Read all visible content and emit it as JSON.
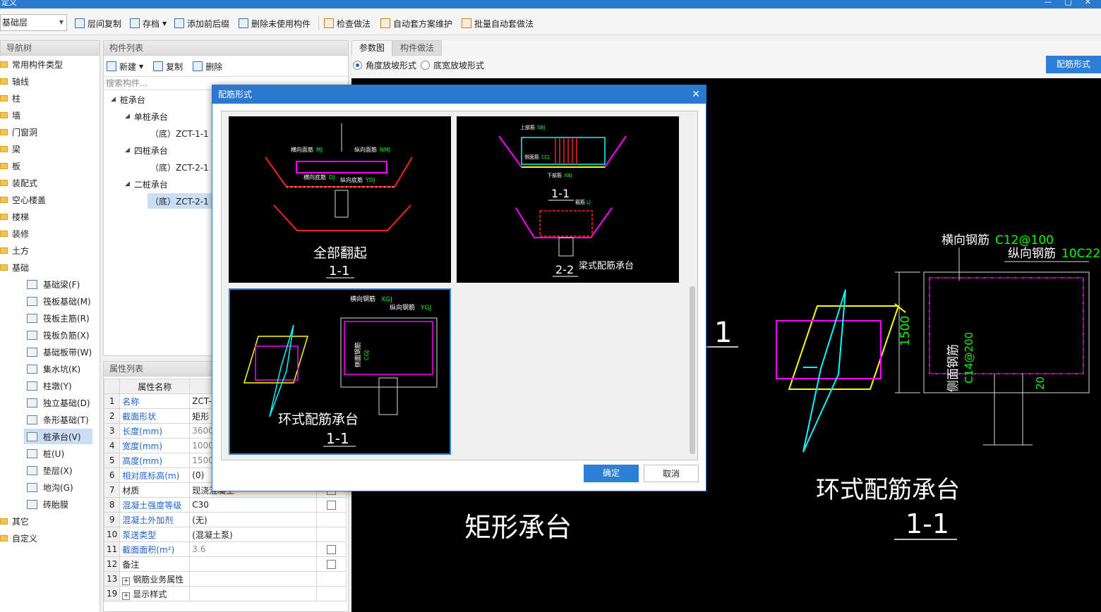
{
  "window": {
    "title": "定义",
    "controls": [
      "—",
      "□",
      "✕"
    ]
  },
  "toolbar": {
    "floor_value": "基础层",
    "items": [
      "层间复制",
      "存档",
      "添加前后缀",
      "删除未使用构件",
      "检查做法",
      "自动套方案维护",
      "批量自动套做法"
    ]
  },
  "nav": {
    "header": "导航树",
    "folders": [
      "常用构件类型",
      "轴线",
      "柱",
      "墙",
      "门窗洞",
      "梁",
      "板",
      "装配式",
      "空心楼盖",
      "楼梯",
      "装修",
      "土方",
      "基础"
    ],
    "foundation_items": [
      "基础梁(F)",
      "筏板基础(M)",
      "筏板主筋(R)",
      "筏板负筋(X)",
      "基础板带(W)",
      "集水坑(K)",
      "柱墩(Y)",
      "独立基础(D)",
      "条形基础(T)",
      "桩承台(V)",
      "桩(U)",
      "垫层(X)",
      "地沟(G)",
      "砖胎膜"
    ],
    "bottom_folders": [
      "其它",
      "自定义"
    ]
  },
  "components": {
    "header": "构件列表",
    "new_label": "新建",
    "copy_label": "复制",
    "delete_label": "删除",
    "search_placeholder": "搜索构件...",
    "root": "桩承台",
    "groups": [
      {
        "name": "单桩承台",
        "item": "（底）ZCT-1-1"
      },
      {
        "name": "四桩承台",
        "item": "（底）ZCT-2-1"
      },
      {
        "name": "二桩承台",
        "item": "（底）ZCT-2-1"
      }
    ]
  },
  "properties": {
    "header": "属性列表",
    "col_name": "属性名称",
    "rows": [
      {
        "n": "1",
        "name": "名称",
        "value": "ZCT-"
      },
      {
        "n": "2",
        "name": "截面形状",
        "value": "矩形"
      },
      {
        "n": "3",
        "name": "长度(mm)",
        "value": "3600"
      },
      {
        "n": "4",
        "name": "宽度(mm)",
        "value": "1000"
      },
      {
        "n": "5",
        "name": "高度(mm)",
        "value": "1500"
      },
      {
        "n": "6",
        "name": "相对底标高(m)",
        "value": "(0)"
      },
      {
        "n": "7",
        "name": "材质",
        "value": "现浇混凝土"
      },
      {
        "n": "8",
        "name": "混凝土强度等级",
        "value": "C30"
      },
      {
        "n": "9",
        "name": "混凝土外加剂",
        "value": "(无)"
      },
      {
        "n": "10",
        "name": "泵送类型",
        "value": "(混凝土泵)"
      },
      {
        "n": "11",
        "name": "截面面积(m²)",
        "value": "3.6"
      },
      {
        "n": "12",
        "name": "备注",
        "value": ""
      },
      {
        "n": "13",
        "name": "钢筋业务属性",
        "value": ""
      },
      {
        "n": "19",
        "name": "显示样式",
        "value": ""
      }
    ]
  },
  "main": {
    "tabs": [
      "参数图",
      "构件做法"
    ],
    "radio_angle": "角度放坡形式",
    "radio_width": "底宽放坡形式",
    "rebar_button": "配筋形式",
    "canvas": {
      "left_title": "矩形承台",
      "right_title": "环式配筋承台",
      "section": "1-1",
      "section_left": "1",
      "label_horizontal": "横向钢筋",
      "value_horizontal": "C12@100",
      "label_longitudinal": "纵向钢筋",
      "value_longitudinal": "10C22",
      "label_side": "侧面钢筋",
      "value_side": "C14@200",
      "dim_height": "1500",
      "dim_cover": "20"
    }
  },
  "dialog": {
    "title": "配筋形式",
    "options": [
      {
        "title": "全部翻起",
        "section": "1-1"
      },
      {
        "title": "梁式配筋承台",
        "section_a": "1-1",
        "section_b": "2-2"
      },
      {
        "title": "环式配筋承台",
        "section": "1-1"
      }
    ],
    "ok": "确定",
    "cancel": "取消",
    "thumb_labels": {
      "t1_top_h": "横向面筋",
      "t1_top_h_code": "MJ",
      "t1_top_v": "纵向面筋",
      "t1_top_v_code": "NMJ",
      "t1_bot_h": "横向底筋",
      "t1_bot_h_code": "DJ",
      "t1_bot_v": "纵向底筋",
      "t1_bot_v_code": "YDJ",
      "t2_top": "上部筋",
      "t2_top_code": "SBJ",
      "t2_side": "侧面筋",
      "t2_side_code": "CCJ",
      "t2_bottom": "下部筋",
      "t2_bottom_code": "XBJ",
      "t2_stirrup": "箍筋",
      "t2_stirrup_code": "LJ",
      "t3_h": "横向钢筋",
      "t3_h_code": "XGJ",
      "t3_v": "纵向钢筋",
      "t3_v_code": "YGJ",
      "t3_side": "侧面钢筋",
      "t3_side_code": "CGJ"
    }
  },
  "colors": {
    "accent": "#2d7ed6",
    "title_bar": "#2a78d0",
    "selection": "#c9def5",
    "rebar_magenta": "#ff00ff",
    "rebar_red": "#ff2020",
    "label_green": "#00ff00"
  }
}
